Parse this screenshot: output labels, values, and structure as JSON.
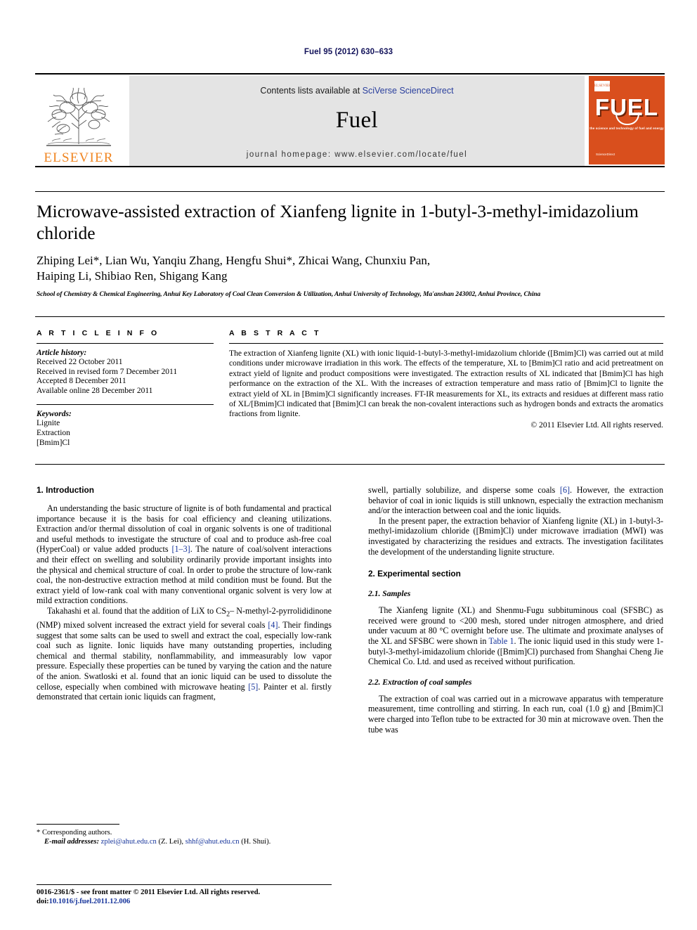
{
  "running_head": "Fuel 95 (2012) 630–633",
  "masthead": {
    "elsevier_wordmark": "ELSEVIER",
    "contents_prefix": "Contents lists available at ",
    "contents_link": "SciVerse ScienceDirect",
    "journal_name": "Fuel",
    "homepage": "journal homepage: www.elsevier.com/locate/fuel",
    "cover": {
      "title": "FUEL",
      "subtitle": "the science and technology of fuel and energy",
      "footer": "ScienceDirect"
    }
  },
  "article": {
    "title": "Microwave-assisted extraction of Xianfeng lignite in 1-butyl-3-methyl-imidazolium chloride",
    "authors_line_1": "Zhiping Lei*, Lian Wu, Yanqiu Zhang, Hengfu Shui*, Zhicai Wang, Chunxiu Pan,",
    "authors_line_2": "Haiping Li, Shibiao Ren, Shigang Kang",
    "affiliation": "School of Chemistry & Chemical Engineering, Anhui Key Laboratory of Coal Clean Conversion & Utilization, Anhui University of Technology, Ma'anshan 243002, Anhui Province, China"
  },
  "info": {
    "heading": "A R T I C L E   I N F O",
    "history_label": "Article history:",
    "history": [
      "Received 22 October 2011",
      "Received in revised form 7 December 2011",
      "Accepted 8 December 2011",
      "Available online 28 December 2011"
    ],
    "keywords_label": "Keywords:",
    "keywords": [
      "Lignite",
      "Extraction",
      "[Bmim]Cl"
    ]
  },
  "abstract": {
    "heading": "A B S T R A C T",
    "text": "The extraction of Xianfeng lignite (XL) with ionic liquid-1-butyl-3-methyl-imidazolium chloride ([Bmim]Cl) was carried out at mild conditions under microwave irradiation in this work. The effects of the temperature, XL to [Bmim]Cl ratio and acid pretreatment on extract yield of lignite and product compositions were investigated. The extraction results of XL indicated that [Bmim]Cl has high performance on the extraction of the XL. With the increases of extraction temperature and mass ratio of [Bmim]Cl to lignite the extract yield of XL in [Bmim]Cl significantly increases. FT-IR measurements for XL, its extracts and residues at different mass ratio of XL/[Bmim]Cl indicated that [Bmim]Cl can break the non-covalent interactions such as hydrogen bonds and extracts the aromatics fractions from lignite.",
    "copyright": "© 2011 Elsevier Ltd. All rights reserved."
  },
  "body": {
    "intro_heading": "1. Introduction",
    "intro_p1_a": "An understanding the basic structure of lignite is of both fundamental and practical importance because it is the basis for coal efficiency and cleaning utilizations. Extraction and/or thermal dissolution of coal in organic solvents is one of traditional and useful methods to investigate the structure of coal and to produce ash-free coal (HyperCoal) or value added products ",
    "intro_p1_ref": "[1–3]",
    "intro_p1_b": ". The nature of coal/solvent interactions and their effect on swelling and solubility ordinarily provide important insights into the physical and chemical structure of coal. In order to probe the structure of low-rank coal, the non-destructive extraction method at mild condition must be found. But the extract yield of low-rank coal with many conventional organic solvent is very low at mild extraction conditions.",
    "intro_p2_a": "Takahashi et al. found that the addition of LiX to CS",
    "intro_p2_sub": "2",
    "intro_p2_b": "– N-methyl-2-pyrrolididinone (NMP) mixed solvent increased the extract yield for several coals ",
    "intro_p2_ref": "[4]",
    "intro_p2_c": ". Their findings suggest that some salts can be used to swell and extract the coal, especially low-rank coal such as lignite. Ionic liquids have many outstanding properties, including chemical and thermal stability, nonflammability, and immeasurably low vapor pressure. Especially these properties can be tuned by varying the cation and the nature of the anion. Swatloski et al. found that an ionic liquid can be used to dissolute the cellose, especially when combined with microwave heating ",
    "intro_p2_ref2": "[5]",
    "intro_p2_d": ". Painter et al. firstly demonstrated that certain ionic liquids can fragment,",
    "right_p1_a": "swell, partially solubilize, and disperse some coals ",
    "right_p1_ref": "[6]",
    "right_p1_b": ". However, the extraction behavior of coal in ionic liquids is still unknown, especially the extraction mechanism and/or the interaction between coal and the ionic liquids.",
    "right_p2": "In the present paper, the extraction behavior of Xianfeng lignite (XL) in 1-butyl-3-methyl-imidazolium chloride ([Bmim]Cl) under microwave irradiation (MWI) was investigated by characterizing the residues and extracts. The investigation facilitates the development of the understanding lignite structure.",
    "exp_heading": "2. Experimental section",
    "samples_heading": "2.1. Samples",
    "samples_p_a": "The Xianfeng lignite (XL) and Shenmu-Fugu subbituminous coal (SFSBC) as received were ground to <200 mesh, stored under nitrogen atmosphere, and dried under vacuum at 80 °C overnight before use. The ultimate and proximate analyses of the XL and SFSBC were shown in ",
    "samples_p_ref": "Table 1",
    "samples_p_b": ". The ionic liquid used in this study were 1-butyl-3-methyl-imidazolium chloride ([Bmim]Cl) purchased from Shanghai Cheng Jie Chemical Co. Ltd. and used as received without purification.",
    "extraction_heading": "2.2. Extraction of coal samples",
    "extraction_p": "The extraction of coal was carried out in a microwave apparatus with temperature measurement, time controlling and stirring. In each run, coal (1.0 g) and [Bmim]Cl were charged into Teflon tube to be extracted for 30 min at microwave oven. Then the tube was"
  },
  "footnote": {
    "star": "*",
    "corresponding": " Corresponding authors.",
    "email_label": "E-mail addresses:",
    "email_1": "zplei@ahut.edu.cn",
    "email_1_name": " (Z. Lei), ",
    "email_2": "shhf@ahut.edu.cn",
    "email_2_name": " (H. Shui)."
  },
  "page_footer": {
    "issn_line": "0016-2361/$ - see front matter © 2011 Elsevier Ltd. All rights reserved.",
    "doi_label": "doi:",
    "doi": "10.1016/j.fuel.2011.12.006"
  },
  "colors": {
    "link_blue": "#2a3f9d",
    "ref_blue": "#16349b",
    "elsevier_orange": "#f08521",
    "cover_orange": "#d94f1d",
    "band_gray": "#e4e4e4"
  }
}
